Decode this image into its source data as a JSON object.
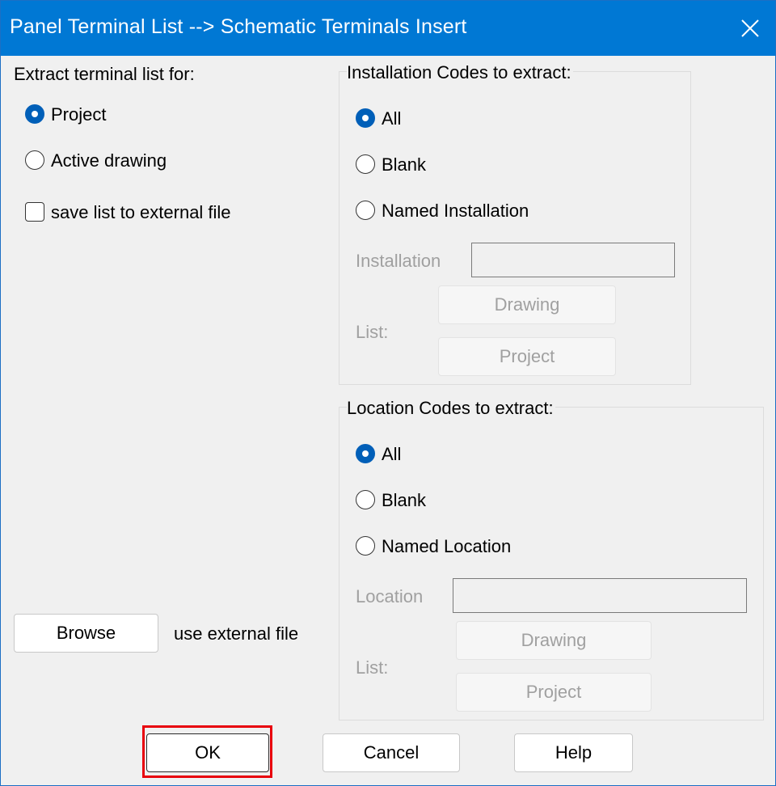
{
  "window": {
    "title": "Panel Terminal List --> Schematic Terminals Insert",
    "close_icon": "close-icon"
  },
  "extract_for": {
    "heading": "Extract terminal list for:",
    "options": [
      {
        "label": "Project",
        "selected": true
      },
      {
        "label": "Active drawing",
        "selected": false
      }
    ],
    "save_checkbox": {
      "label": "save list to external file",
      "checked": false
    }
  },
  "installation": {
    "heading": "Installation Codes to extract:",
    "options": [
      {
        "label": "All",
        "selected": true
      },
      {
        "label": "Blank",
        "selected": false
      },
      {
        "label": "Named Installation",
        "selected": false
      }
    ],
    "field_label": "Installation",
    "field_value": "",
    "list_label": "List:",
    "drawing_button": "Drawing",
    "project_button": "Project"
  },
  "location": {
    "heading": "Location Codes to extract:",
    "options": [
      {
        "label": "All",
        "selected": true
      },
      {
        "label": "Blank",
        "selected": false
      },
      {
        "label": "Named Location",
        "selected": false
      }
    ],
    "field_label": "Location",
    "field_value": "",
    "list_label": "List:",
    "drawing_button": "Drawing",
    "project_button": "Project"
  },
  "external": {
    "browse_button": "Browse",
    "label": "use external file"
  },
  "footer": {
    "ok": "OK",
    "cancel": "Cancel",
    "help": "Help"
  },
  "colors": {
    "titlebar": "#0078d4",
    "radio_selected": "#005fb8",
    "highlight": "#e8000b"
  }
}
